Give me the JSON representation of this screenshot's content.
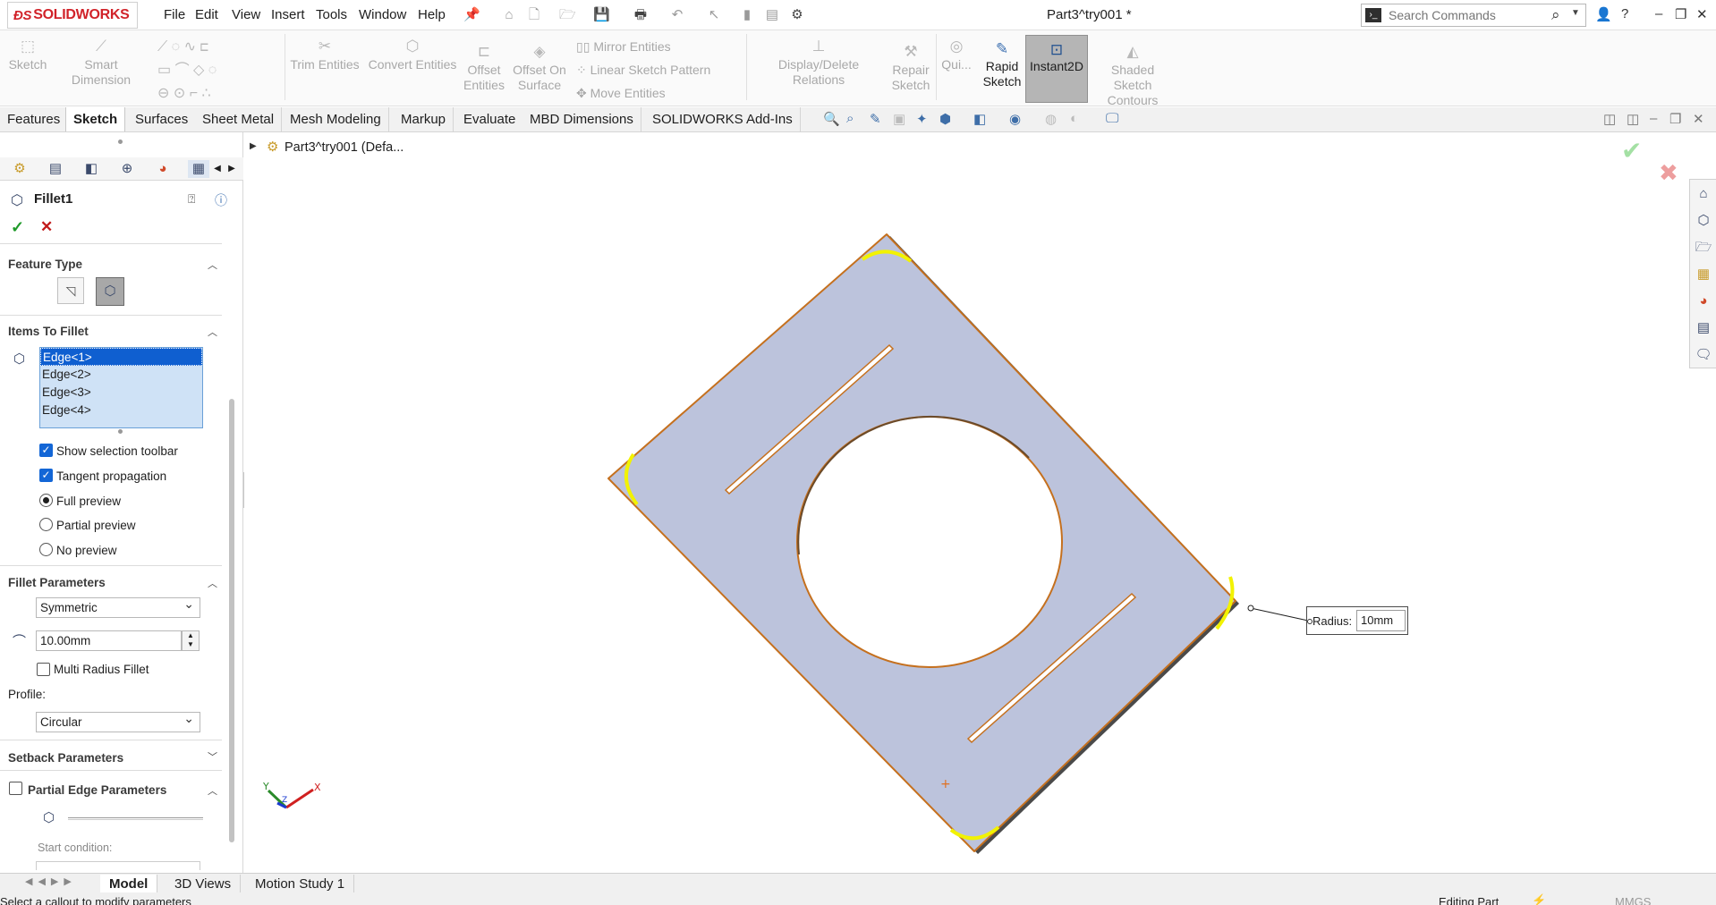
{
  "app": {
    "brand": "SOLIDWORKS",
    "document_title": "Part3^try001 *",
    "menu": [
      "File",
      "Edit",
      "View",
      "Insert",
      "Tools",
      "Window",
      "Help"
    ],
    "search_placeholder": "Search Commands"
  },
  "command_manager": {
    "sketch": "Sketch",
    "smart_dimension": "Smart Dimension",
    "trim_entities": "Trim Entities",
    "convert_entities": "Convert Entities",
    "offset_entities_1": "Offset",
    "offset_entities_2": "Entities",
    "offset_surface_1": "Offset On",
    "offset_surface_2": "Surface",
    "mirror_entities": "Mirror Entities",
    "linear_pattern": "Linear Sketch Pattern",
    "move_entities": "Move Entities",
    "display_relations": "Display/Delete Relations",
    "repair_sketch_1": "Repair",
    "repair_sketch_2": "Sketch",
    "quick_snaps": "Qui...",
    "rapid_sketch_1": "Rapid",
    "rapid_sketch_2": "Sketch",
    "instant2d": "Instant2D",
    "shaded_contours_1": "Shaded Sketch",
    "shaded_contours_2": "Contours"
  },
  "tabs": [
    "Features",
    "Sketch",
    "Surfaces",
    "Sheet Metal",
    "Mesh Modeling",
    "Markup",
    "Evaluate",
    "MBD Dimensions",
    "SOLIDWORKS Add-Ins"
  ],
  "active_tab": "Sketch",
  "property_manager": {
    "title": "Fillet1",
    "feature_type": "Feature Type",
    "items_to_fillet": "Items To Fillet",
    "edges": [
      "Edge<1>",
      "Edge<2>",
      "Edge<3>",
      "Edge<4>"
    ],
    "show_selection_toolbar": "Show selection toolbar",
    "tangent_propagation": "Tangent propagation",
    "full_preview": "Full preview",
    "partial_preview": "Partial preview",
    "no_preview": "No preview",
    "fillet_parameters": "Fillet Parameters",
    "fillet_method": "Symmetric",
    "radius": "10.00mm",
    "multi_radius": "Multi Radius Fillet",
    "profile_label": "Profile:",
    "profile": "Circular",
    "setback_parameters": "Setback Parameters",
    "partial_edge_parameters": "Partial Edge Parameters",
    "start_condition": "Start condition:"
  },
  "feature_tree_item": "Part3^try001  (Defa...",
  "callout": {
    "label": "Radius:",
    "value": "10mm"
  },
  "bottom_tabs": [
    "Model",
    "3D Views",
    "Motion Study 1"
  ],
  "status": {
    "left": "Select a callout to modify parameters",
    "right": "Editing Part",
    "units": "MMGS"
  },
  "colors": {
    "part_fill": "#bcc3dc",
    "edge": "#c5701e",
    "highlight": "#f2f200",
    "brand": "#d1232a",
    "selection": "#0f5fd0"
  }
}
